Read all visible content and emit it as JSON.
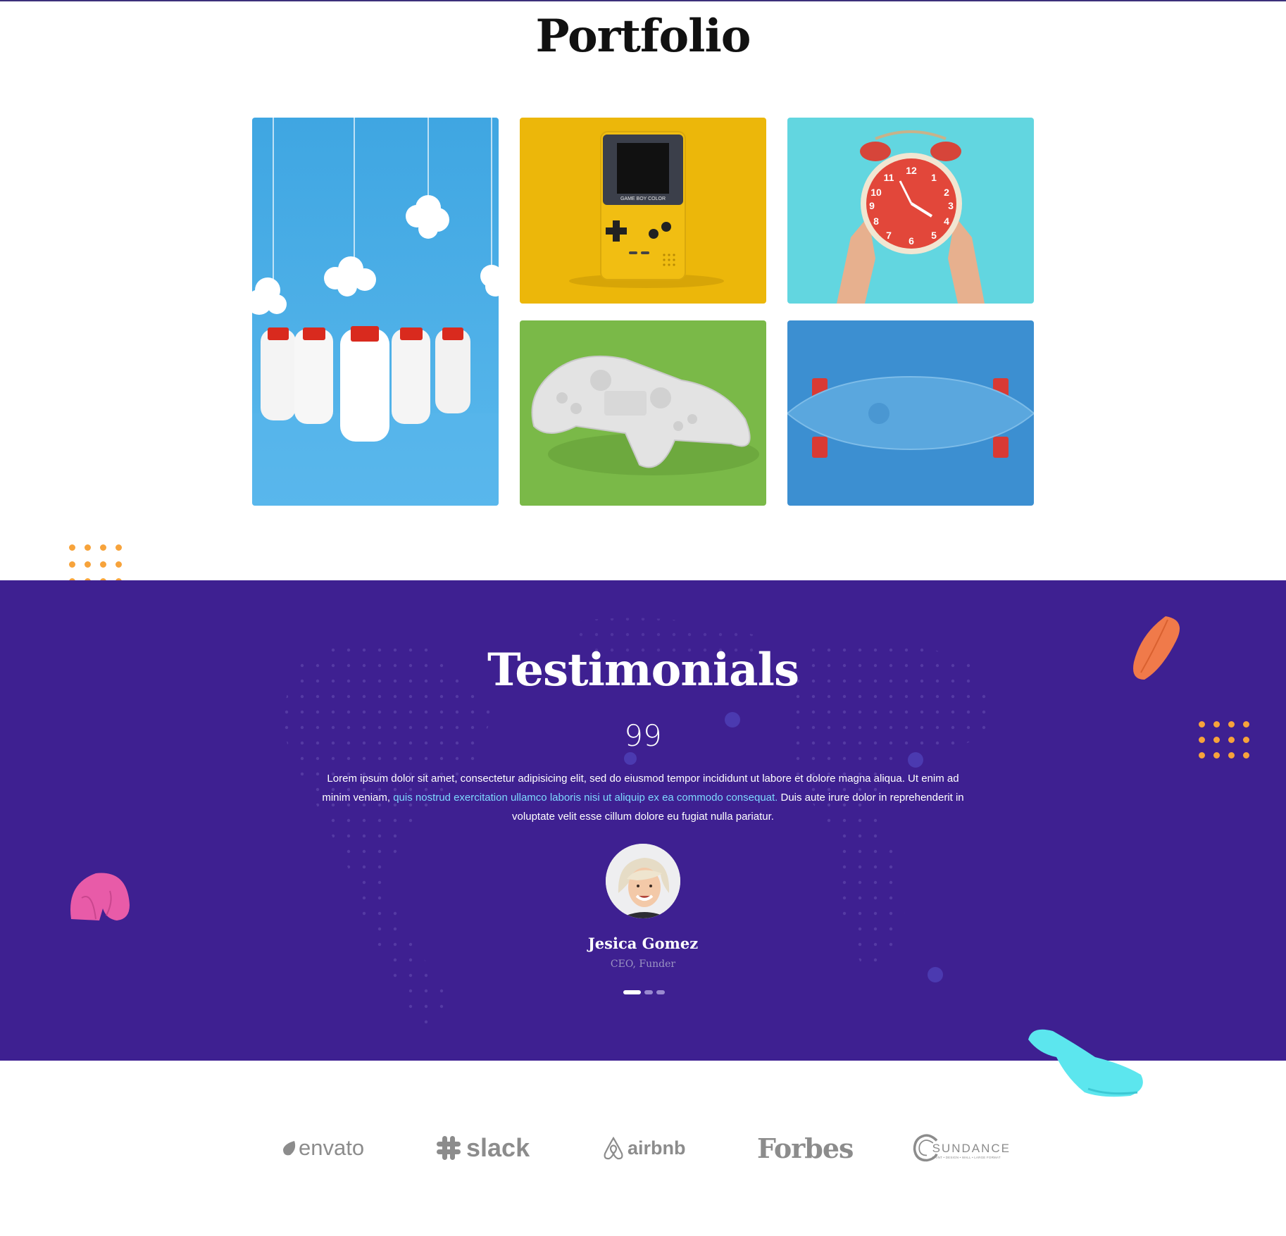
{
  "portfolio": {
    "title": "Portfolio",
    "items": [
      {
        "subject": "milk bottles with clouds",
        "bg": "#45aee6"
      },
      {
        "subject": "yellow game boy color",
        "bg": "#ecb70a"
      },
      {
        "subject": "red alarm clock held by hands",
        "bg": "#62d6e0"
      },
      {
        "subject": "white game controller",
        "bg": "#7ab948"
      },
      {
        "subject": "blue skateboard",
        "bg": "#3c8fd1"
      }
    ],
    "gameboy_label": "GAME BOY COLOR"
  },
  "testimonials": {
    "title": "Testimonials",
    "quote_mark": "99",
    "text_before": "Lorem ipsum dolor sit amet, consectetur adipisicing elit, sed do eiusmod tempor incididunt ut labore et dolore magna aliqua. Ut enim ad minim veniam, ",
    "text_highlight": "quis nostrud exercitation ullamco laboris nisi ut aliquip ex ea commodo consequat.",
    "text_after": " Duis aute irure dolor in reprehenderit in voluptate velit esse cillum dolore eu fugiat nulla pariatur.",
    "name": "Jesica Gomez",
    "role": "CEO, Funder",
    "slides": 3,
    "active_slide": 0,
    "colors": {
      "bg": "#3e2091",
      "highlight": "#7ed8ff"
    }
  },
  "logos": {
    "envato": "envato",
    "slack": "slack",
    "airbnb": "airbnb",
    "forbes": "Forbes",
    "sundance": "SUNDANCE",
    "sundance_sub": "PRINT • DESIGN • WALL • LARGE FORMAT"
  },
  "colors": {
    "dots_orange": "#f7a33b",
    "shape_pink": "#e85ba8",
    "shape_orange": "#f07a4a",
    "shape_cyan": "#5ce6ee"
  }
}
